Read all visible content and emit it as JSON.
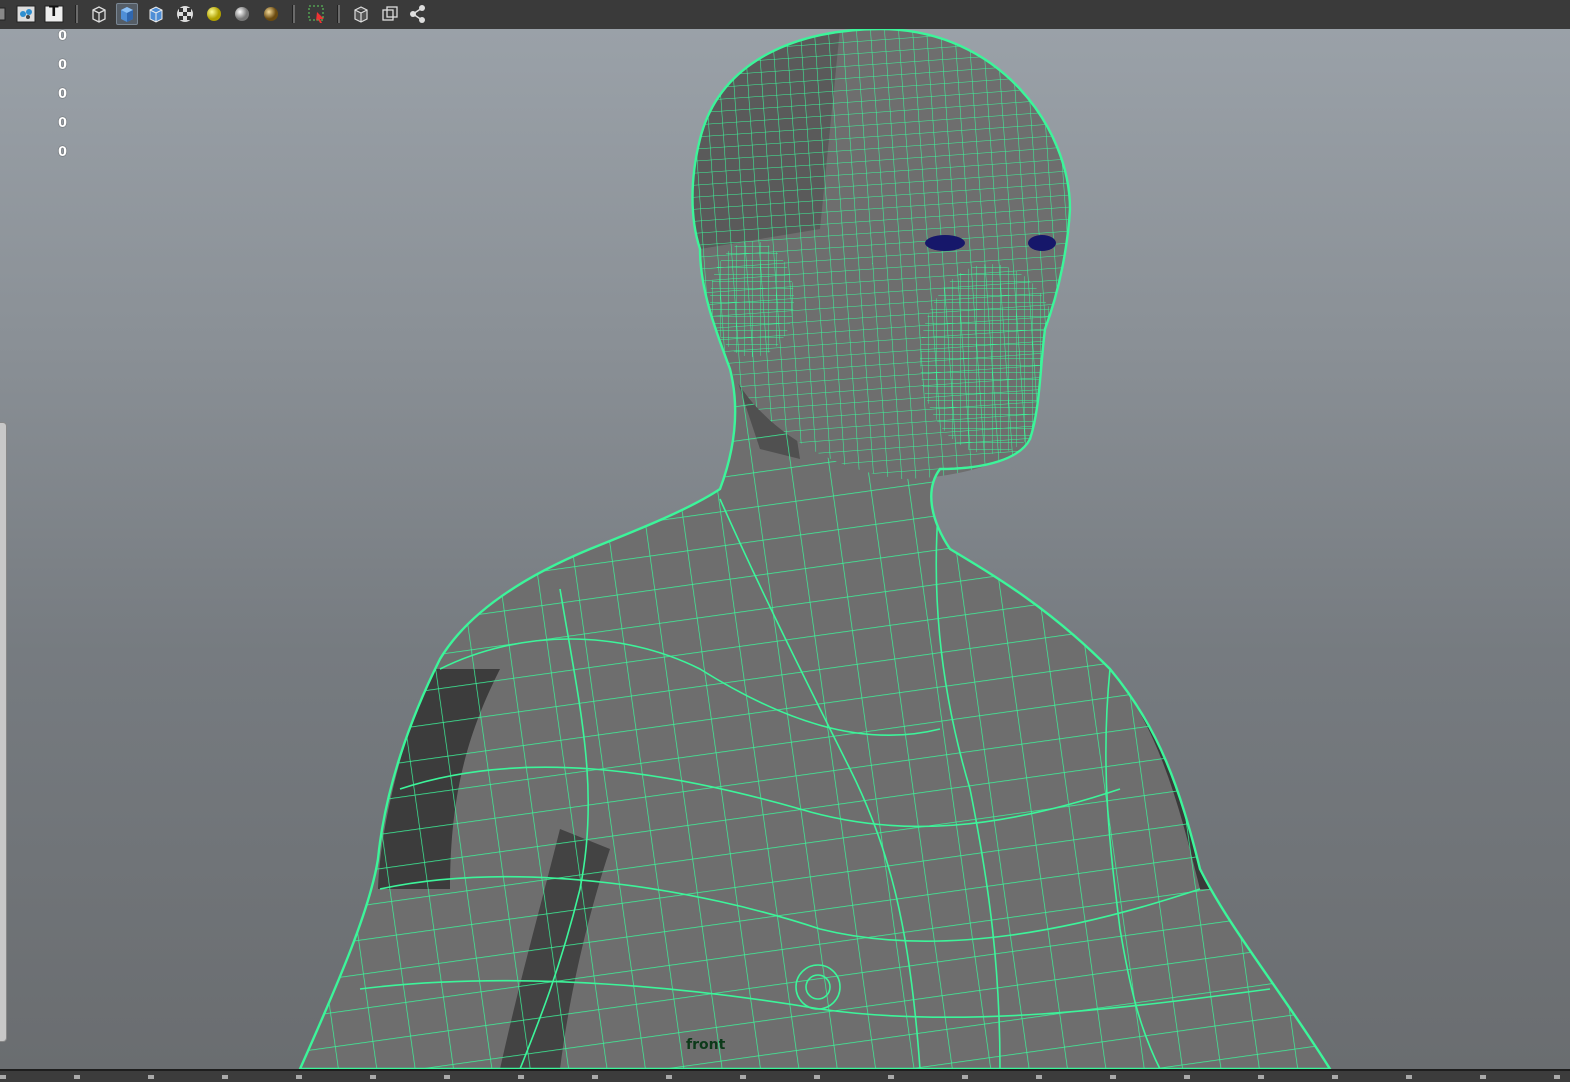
{
  "toolbar": {
    "icons": [
      "wireframe-on-shaded-icon",
      "text-t-icon",
      "wireframe-cube-icon",
      "smooth-shade-cube-icon",
      "wireframe-on-shaded-cube-icon",
      "checker-texture-icon",
      "default-light-icon",
      "all-lights-sphere-icon",
      "shadows-sphere-icon",
      "xray-select-icon",
      "isolate-select-icon",
      "bounding-box-icon",
      "node-graph-icon"
    ],
    "text_icon_glyph": "T",
    "pressed": [
      "smooth-shade-cube-icon"
    ]
  },
  "hud": {
    "values": [
      "0",
      "0",
      "0",
      "0",
      "0"
    ]
  },
  "viewport": {
    "camera_label": "front",
    "wire_color": "#3cf59a",
    "eye_color": "#16176a"
  }
}
